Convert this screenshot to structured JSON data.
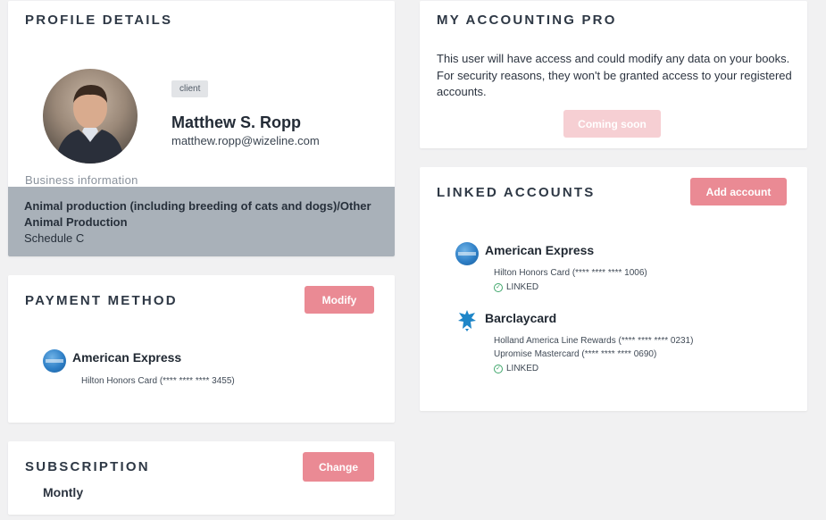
{
  "profile": {
    "title": "PROFILE DETAILS",
    "badge": "client",
    "name": "Matthew S. Ropp",
    "email": "matthew.ropp@wizeline.com",
    "business_label": "Business information",
    "business_name": "Animal production (including breeding of cats and dogs)/Other Animal Production",
    "schedule": "Schedule C"
  },
  "payment": {
    "title": "PAYMENT METHOD",
    "button": "Modify",
    "card_name": "American Express",
    "card_detail": "Hilton Honors Card (**** **** **** 3455)",
    "icon": "amex-icon"
  },
  "subscription": {
    "title": "SUBSCRIPTION",
    "button": "Change",
    "plan": "Montly"
  },
  "accounting_pro": {
    "title": "MY ACCOUNTING PRO",
    "description": "This user will have access and could modify any data on your books. For security reasons, they won't be granted access to your registered accounts.",
    "button": "Coming soon"
  },
  "linked_accounts": {
    "title": "LINKED ACCOUNTS",
    "button": "Add account",
    "accounts": [
      {
        "name": "American Express",
        "icon": "amex-icon",
        "cards": [
          "Hilton Honors Card (**** **** **** 1006)"
        ],
        "status": "LINKED"
      },
      {
        "name": "Barclaycard",
        "icon": "barclays-eagle-icon",
        "cards": [
          "Holland America Line Rewards (**** **** **** 0231)",
          "Upromise Mastercard (**** **** **** 0690)"
        ],
        "status": "LINKED"
      }
    ]
  },
  "colors": {
    "accent": "#ea8a94",
    "accent_disabled": "#f6cfd3",
    "business_bg": "#a9b1b9",
    "linked_green": "#3fa66b"
  }
}
